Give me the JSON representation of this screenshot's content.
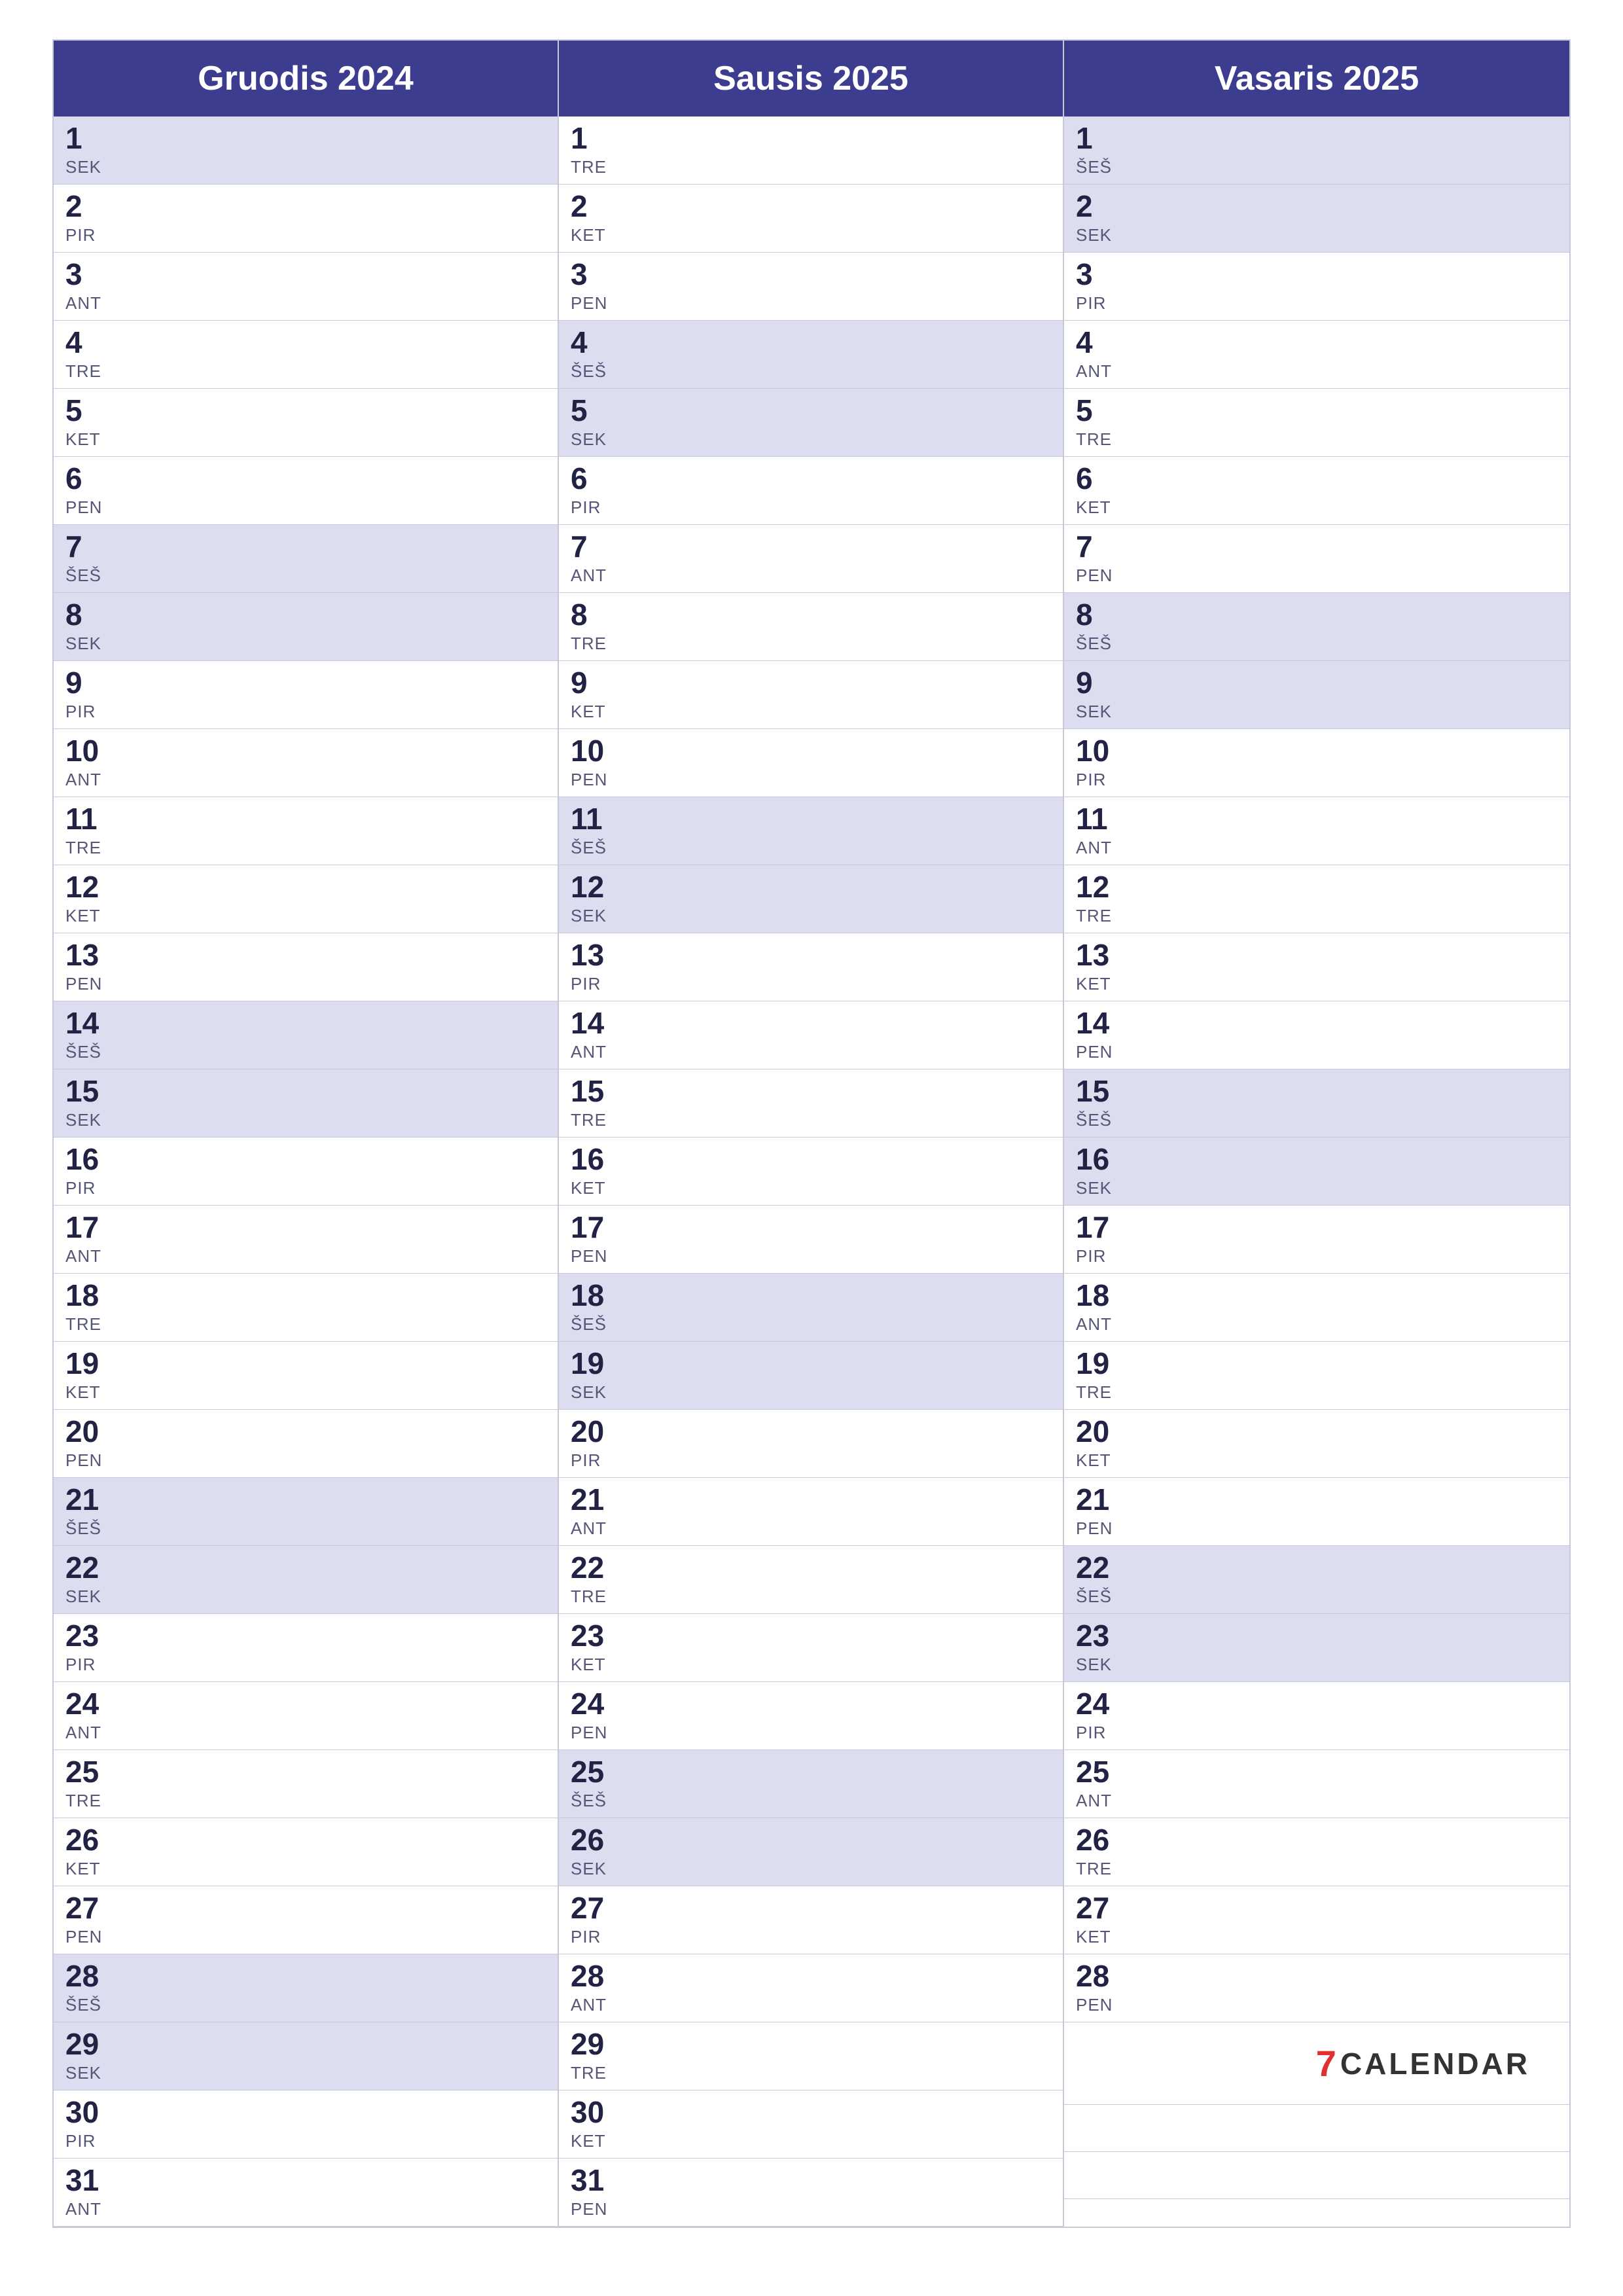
{
  "months": [
    {
      "name": "Gruodis 2024",
      "days": [
        {
          "num": "1",
          "day": "SEK",
          "weekend": true
        },
        {
          "num": "2",
          "day": "PIR",
          "weekend": false
        },
        {
          "num": "3",
          "day": "ANT",
          "weekend": false
        },
        {
          "num": "4",
          "day": "TRE",
          "weekend": false
        },
        {
          "num": "5",
          "day": "KET",
          "weekend": false
        },
        {
          "num": "6",
          "day": "PEN",
          "weekend": false
        },
        {
          "num": "7",
          "day": "ŠEŠ",
          "weekend": true
        },
        {
          "num": "8",
          "day": "SEK",
          "weekend": true
        },
        {
          "num": "9",
          "day": "PIR",
          "weekend": false
        },
        {
          "num": "10",
          "day": "ANT",
          "weekend": false
        },
        {
          "num": "11",
          "day": "TRE",
          "weekend": false
        },
        {
          "num": "12",
          "day": "KET",
          "weekend": false
        },
        {
          "num": "13",
          "day": "PEN",
          "weekend": false
        },
        {
          "num": "14",
          "day": "ŠEŠ",
          "weekend": true
        },
        {
          "num": "15",
          "day": "SEK",
          "weekend": true
        },
        {
          "num": "16",
          "day": "PIR",
          "weekend": false
        },
        {
          "num": "17",
          "day": "ANT",
          "weekend": false
        },
        {
          "num": "18",
          "day": "TRE",
          "weekend": false
        },
        {
          "num": "19",
          "day": "KET",
          "weekend": false
        },
        {
          "num": "20",
          "day": "PEN",
          "weekend": false
        },
        {
          "num": "21",
          "day": "ŠEŠ",
          "weekend": true
        },
        {
          "num": "22",
          "day": "SEK",
          "weekend": true
        },
        {
          "num": "23",
          "day": "PIR",
          "weekend": false
        },
        {
          "num": "24",
          "day": "ANT",
          "weekend": false
        },
        {
          "num": "25",
          "day": "TRE",
          "weekend": false
        },
        {
          "num": "26",
          "day": "KET",
          "weekend": false
        },
        {
          "num": "27",
          "day": "PEN",
          "weekend": false
        },
        {
          "num": "28",
          "day": "ŠEŠ",
          "weekend": true
        },
        {
          "num": "29",
          "day": "SEK",
          "weekend": true
        },
        {
          "num": "30",
          "day": "PIR",
          "weekend": false
        },
        {
          "num": "31",
          "day": "ANT",
          "weekend": false
        }
      ]
    },
    {
      "name": "Sausis 2025",
      "days": [
        {
          "num": "1",
          "day": "TRE",
          "weekend": false
        },
        {
          "num": "2",
          "day": "KET",
          "weekend": false
        },
        {
          "num": "3",
          "day": "PEN",
          "weekend": false
        },
        {
          "num": "4",
          "day": "ŠEŠ",
          "weekend": true
        },
        {
          "num": "5",
          "day": "SEK",
          "weekend": true
        },
        {
          "num": "6",
          "day": "PIR",
          "weekend": false
        },
        {
          "num": "7",
          "day": "ANT",
          "weekend": false
        },
        {
          "num": "8",
          "day": "TRE",
          "weekend": false
        },
        {
          "num": "9",
          "day": "KET",
          "weekend": false
        },
        {
          "num": "10",
          "day": "PEN",
          "weekend": false
        },
        {
          "num": "11",
          "day": "ŠEŠ",
          "weekend": true
        },
        {
          "num": "12",
          "day": "SEK",
          "weekend": true
        },
        {
          "num": "13",
          "day": "PIR",
          "weekend": false
        },
        {
          "num": "14",
          "day": "ANT",
          "weekend": false
        },
        {
          "num": "15",
          "day": "TRE",
          "weekend": false
        },
        {
          "num": "16",
          "day": "KET",
          "weekend": false
        },
        {
          "num": "17",
          "day": "PEN",
          "weekend": false
        },
        {
          "num": "18",
          "day": "ŠEŠ",
          "weekend": true
        },
        {
          "num": "19",
          "day": "SEK",
          "weekend": true
        },
        {
          "num": "20",
          "day": "PIR",
          "weekend": false
        },
        {
          "num": "21",
          "day": "ANT",
          "weekend": false
        },
        {
          "num": "22",
          "day": "TRE",
          "weekend": false
        },
        {
          "num": "23",
          "day": "KET",
          "weekend": false
        },
        {
          "num": "24",
          "day": "PEN",
          "weekend": false
        },
        {
          "num": "25",
          "day": "ŠEŠ",
          "weekend": true
        },
        {
          "num": "26",
          "day": "SEK",
          "weekend": true
        },
        {
          "num": "27",
          "day": "PIR",
          "weekend": false
        },
        {
          "num": "28",
          "day": "ANT",
          "weekend": false
        },
        {
          "num": "29",
          "day": "TRE",
          "weekend": false
        },
        {
          "num": "30",
          "day": "KET",
          "weekend": false
        },
        {
          "num": "31",
          "day": "PEN",
          "weekend": false
        }
      ]
    },
    {
      "name": "Vasaris 2025",
      "days": [
        {
          "num": "1",
          "day": "ŠEŠ",
          "weekend": true
        },
        {
          "num": "2",
          "day": "SEK",
          "weekend": true
        },
        {
          "num": "3",
          "day": "PIR",
          "weekend": false
        },
        {
          "num": "4",
          "day": "ANT",
          "weekend": false
        },
        {
          "num": "5",
          "day": "TRE",
          "weekend": false
        },
        {
          "num": "6",
          "day": "KET",
          "weekend": false
        },
        {
          "num": "7",
          "day": "PEN",
          "weekend": false
        },
        {
          "num": "8",
          "day": "ŠEŠ",
          "weekend": true
        },
        {
          "num": "9",
          "day": "SEK",
          "weekend": true
        },
        {
          "num": "10",
          "day": "PIR",
          "weekend": false
        },
        {
          "num": "11",
          "day": "ANT",
          "weekend": false
        },
        {
          "num": "12",
          "day": "TRE",
          "weekend": false
        },
        {
          "num": "13",
          "day": "KET",
          "weekend": false
        },
        {
          "num": "14",
          "day": "PEN",
          "weekend": false
        },
        {
          "num": "15",
          "day": "ŠEŠ",
          "weekend": true
        },
        {
          "num": "16",
          "day": "SEK",
          "weekend": true
        },
        {
          "num": "17",
          "day": "PIR",
          "weekend": false
        },
        {
          "num": "18",
          "day": "ANT",
          "weekend": false
        },
        {
          "num": "19",
          "day": "TRE",
          "weekend": false
        },
        {
          "num": "20",
          "day": "KET",
          "weekend": false
        },
        {
          "num": "21",
          "day": "PEN",
          "weekend": false
        },
        {
          "num": "22",
          "day": "ŠEŠ",
          "weekend": true
        },
        {
          "num": "23",
          "day": "SEK",
          "weekend": true
        },
        {
          "num": "24",
          "day": "PIR",
          "weekend": false
        },
        {
          "num": "25",
          "day": "ANT",
          "weekend": false
        },
        {
          "num": "26",
          "day": "TRE",
          "weekend": false
        },
        {
          "num": "27",
          "day": "KET",
          "weekend": false
        },
        {
          "num": "28",
          "day": "PEN",
          "weekend": false
        }
      ]
    }
  ],
  "logo": {
    "number": "7",
    "text": "CALENDAR"
  }
}
